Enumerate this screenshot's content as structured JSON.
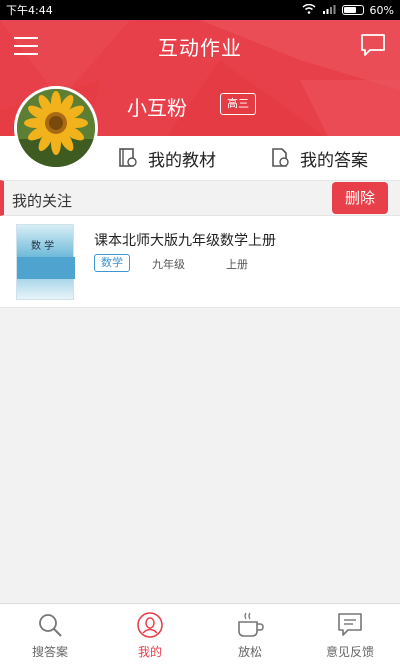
{
  "status": {
    "time": "下午4:44",
    "battery": "60%"
  },
  "header": {
    "title": "互动作业"
  },
  "profile": {
    "username": "小互粉",
    "grade": "高三"
  },
  "quick_links": {
    "textbook": "我的教材",
    "answers": "我的答案"
  },
  "section": {
    "title": "我的关注",
    "delete_label": "删除"
  },
  "follow_items": [
    {
      "title": "课本北师大版九年级数学上册",
      "subject": "数学",
      "grade": "九年级",
      "volume": "上册",
      "cover_text": "数 学"
    }
  ],
  "tabs": [
    {
      "label": "搜答案",
      "icon": "search-icon",
      "active": false
    },
    {
      "label": "我的",
      "icon": "user-icon",
      "active": true
    },
    {
      "label": "放松",
      "icon": "coffee-icon",
      "active": false
    },
    {
      "label": "意见反馈",
      "icon": "feedback-icon",
      "active": false
    }
  ],
  "colors": {
    "accent": "#e8404a",
    "tag_blue": "#3f95d1",
    "background": "#f2f2f2"
  }
}
